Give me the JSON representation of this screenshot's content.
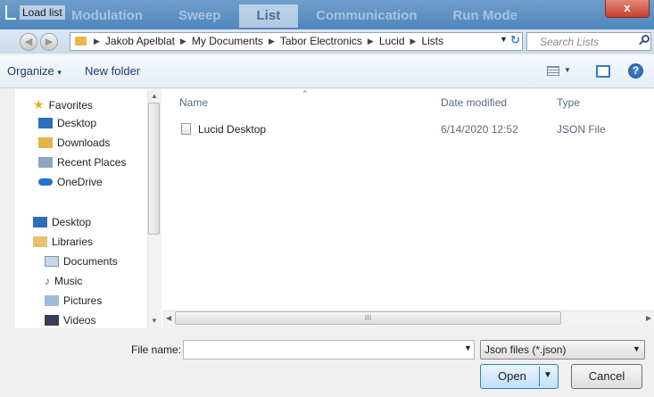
{
  "window": {
    "title": "Load list",
    "background_tabs": [
      "Modulation",
      "Sweep",
      "List",
      "Communication",
      "Run Mode"
    ],
    "active_background_tab": "List",
    "close_glyph": "x"
  },
  "address_bar": {
    "breadcrumbs": [
      "Jakob Apelblat",
      "My Documents",
      "Tabor Electronics",
      "Lucid",
      "Lists"
    ]
  },
  "search": {
    "placeholder": "Search Lists"
  },
  "toolbar": {
    "organize_label": "Organize",
    "organize_arrow": "▾",
    "new_folder_label": "New folder",
    "help_glyph": "?"
  },
  "nav_pane": {
    "favorites_label": "Favorites",
    "favorites": [
      "Desktop",
      "Downloads",
      "Recent Places",
      "OneDrive"
    ],
    "desktop_label": "Desktop",
    "libraries_label": "Libraries",
    "libraries": [
      "Documents",
      "Music",
      "Pictures",
      "Videos"
    ]
  },
  "file_list": {
    "columns": [
      "Name",
      "Date modified",
      "Type"
    ],
    "rows": [
      {
        "name": "Lucid Desktop",
        "date_modified": "6/14/2020 12:52",
        "type": "JSON File"
      }
    ]
  },
  "scroll_glyph": "III",
  "bottom": {
    "file_name_label": "File name:",
    "file_name_value": "",
    "filter_value": "Json files (*.json)",
    "open_label": "Open",
    "cancel_label": "Cancel"
  },
  "colors": {
    "titlebar": "#5b8fc3",
    "close_button": "#c8402c",
    "accent_blue": "#3b7bc7"
  }
}
